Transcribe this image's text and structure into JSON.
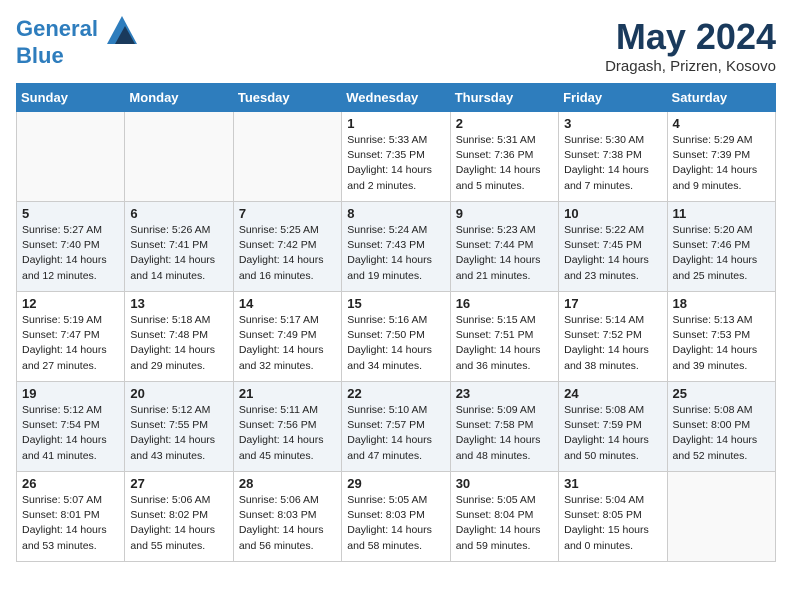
{
  "header": {
    "logo_line1": "General",
    "logo_line2": "Blue",
    "month_title": "May 2024",
    "subtitle": "Dragash, Prizren, Kosovo"
  },
  "weekdays": [
    "Sunday",
    "Monday",
    "Tuesday",
    "Wednesday",
    "Thursday",
    "Friday",
    "Saturday"
  ],
  "weeks": [
    [
      {
        "day": "",
        "info": ""
      },
      {
        "day": "",
        "info": ""
      },
      {
        "day": "",
        "info": ""
      },
      {
        "day": "1",
        "info": "Sunrise: 5:33 AM\nSunset: 7:35 PM\nDaylight: 14 hours\nand 2 minutes."
      },
      {
        "day": "2",
        "info": "Sunrise: 5:31 AM\nSunset: 7:36 PM\nDaylight: 14 hours\nand 5 minutes."
      },
      {
        "day": "3",
        "info": "Sunrise: 5:30 AM\nSunset: 7:38 PM\nDaylight: 14 hours\nand 7 minutes."
      },
      {
        "day": "4",
        "info": "Sunrise: 5:29 AM\nSunset: 7:39 PM\nDaylight: 14 hours\nand 9 minutes."
      }
    ],
    [
      {
        "day": "5",
        "info": "Sunrise: 5:27 AM\nSunset: 7:40 PM\nDaylight: 14 hours\nand 12 minutes."
      },
      {
        "day": "6",
        "info": "Sunrise: 5:26 AM\nSunset: 7:41 PM\nDaylight: 14 hours\nand 14 minutes."
      },
      {
        "day": "7",
        "info": "Sunrise: 5:25 AM\nSunset: 7:42 PM\nDaylight: 14 hours\nand 16 minutes."
      },
      {
        "day": "8",
        "info": "Sunrise: 5:24 AM\nSunset: 7:43 PM\nDaylight: 14 hours\nand 19 minutes."
      },
      {
        "day": "9",
        "info": "Sunrise: 5:23 AM\nSunset: 7:44 PM\nDaylight: 14 hours\nand 21 minutes."
      },
      {
        "day": "10",
        "info": "Sunrise: 5:22 AM\nSunset: 7:45 PM\nDaylight: 14 hours\nand 23 minutes."
      },
      {
        "day": "11",
        "info": "Sunrise: 5:20 AM\nSunset: 7:46 PM\nDaylight: 14 hours\nand 25 minutes."
      }
    ],
    [
      {
        "day": "12",
        "info": "Sunrise: 5:19 AM\nSunset: 7:47 PM\nDaylight: 14 hours\nand 27 minutes."
      },
      {
        "day": "13",
        "info": "Sunrise: 5:18 AM\nSunset: 7:48 PM\nDaylight: 14 hours\nand 29 minutes."
      },
      {
        "day": "14",
        "info": "Sunrise: 5:17 AM\nSunset: 7:49 PM\nDaylight: 14 hours\nand 32 minutes."
      },
      {
        "day": "15",
        "info": "Sunrise: 5:16 AM\nSunset: 7:50 PM\nDaylight: 14 hours\nand 34 minutes."
      },
      {
        "day": "16",
        "info": "Sunrise: 5:15 AM\nSunset: 7:51 PM\nDaylight: 14 hours\nand 36 minutes."
      },
      {
        "day": "17",
        "info": "Sunrise: 5:14 AM\nSunset: 7:52 PM\nDaylight: 14 hours\nand 38 minutes."
      },
      {
        "day": "18",
        "info": "Sunrise: 5:13 AM\nSunset: 7:53 PM\nDaylight: 14 hours\nand 39 minutes."
      }
    ],
    [
      {
        "day": "19",
        "info": "Sunrise: 5:12 AM\nSunset: 7:54 PM\nDaylight: 14 hours\nand 41 minutes."
      },
      {
        "day": "20",
        "info": "Sunrise: 5:12 AM\nSunset: 7:55 PM\nDaylight: 14 hours\nand 43 minutes."
      },
      {
        "day": "21",
        "info": "Sunrise: 5:11 AM\nSunset: 7:56 PM\nDaylight: 14 hours\nand 45 minutes."
      },
      {
        "day": "22",
        "info": "Sunrise: 5:10 AM\nSunset: 7:57 PM\nDaylight: 14 hours\nand 47 minutes."
      },
      {
        "day": "23",
        "info": "Sunrise: 5:09 AM\nSunset: 7:58 PM\nDaylight: 14 hours\nand 48 minutes."
      },
      {
        "day": "24",
        "info": "Sunrise: 5:08 AM\nSunset: 7:59 PM\nDaylight: 14 hours\nand 50 minutes."
      },
      {
        "day": "25",
        "info": "Sunrise: 5:08 AM\nSunset: 8:00 PM\nDaylight: 14 hours\nand 52 minutes."
      }
    ],
    [
      {
        "day": "26",
        "info": "Sunrise: 5:07 AM\nSunset: 8:01 PM\nDaylight: 14 hours\nand 53 minutes."
      },
      {
        "day": "27",
        "info": "Sunrise: 5:06 AM\nSunset: 8:02 PM\nDaylight: 14 hours\nand 55 minutes."
      },
      {
        "day": "28",
        "info": "Sunrise: 5:06 AM\nSunset: 8:03 PM\nDaylight: 14 hours\nand 56 minutes."
      },
      {
        "day": "29",
        "info": "Sunrise: 5:05 AM\nSunset: 8:03 PM\nDaylight: 14 hours\nand 58 minutes."
      },
      {
        "day": "30",
        "info": "Sunrise: 5:05 AM\nSunset: 8:04 PM\nDaylight: 14 hours\nand 59 minutes."
      },
      {
        "day": "31",
        "info": "Sunrise: 5:04 AM\nSunset: 8:05 PM\nDaylight: 15 hours\nand 0 minutes."
      },
      {
        "day": "",
        "info": ""
      }
    ]
  ]
}
